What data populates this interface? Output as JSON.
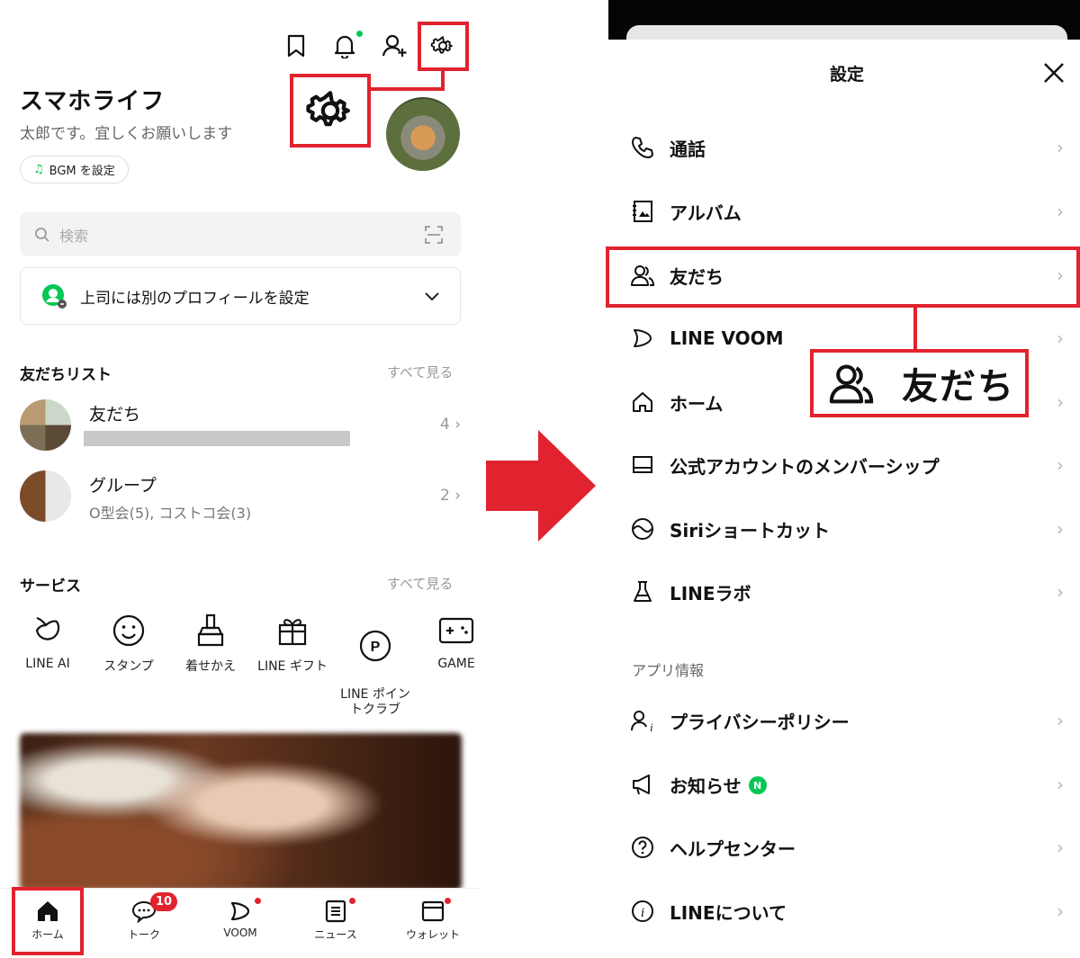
{
  "left": {
    "profile": {
      "name": "スマホライフ",
      "status": "太郎です。宜しくお願いします",
      "bgm_label": "BGM を設定"
    },
    "search": {
      "placeholder": "検索"
    },
    "profile_setting": {
      "label": "上司には別のプロフィールを設定"
    },
    "friends_list": {
      "title": "友だちリスト",
      "see_all": "すべて見る",
      "rows": [
        {
          "title": "友だち",
          "sub": "",
          "count": "4"
        },
        {
          "title": "グループ",
          "sub": "O型会(5), コストコ会(3)",
          "count": "2"
        }
      ]
    },
    "services": {
      "title": "サービス",
      "see_all": "すべて見る",
      "items": [
        {
          "label": "LINE AI",
          "icon": "line-ai-icon"
        },
        {
          "label": "スタンプ",
          "icon": "smiley-icon"
        },
        {
          "label": "着せかえ",
          "icon": "brush-icon"
        },
        {
          "label": "LINE ギフト",
          "icon": "gift-icon"
        },
        {
          "label": "LINE ポイン\nトクラブ",
          "icon": "point-icon"
        },
        {
          "label": "GAME",
          "icon": "gamepad-icon"
        }
      ]
    },
    "tabs": [
      {
        "label": "ホーム",
        "icon": "home-icon"
      },
      {
        "label": "トーク",
        "icon": "chat-icon",
        "badge": "10"
      },
      {
        "label": "VOOM",
        "icon": "voom-icon"
      },
      {
        "label": "ニュース",
        "icon": "news-icon"
      },
      {
        "label": "ウォレット",
        "icon": "wallet-icon"
      }
    ]
  },
  "right": {
    "title": "設定",
    "menu": [
      {
        "label": "通話",
        "icon": "phone-icon"
      },
      {
        "label": "アルバム",
        "icon": "album-icon"
      },
      {
        "label": "友だち",
        "icon": "friends-icon"
      },
      {
        "label": "LINE VOOM",
        "icon": "voom-icon"
      },
      {
        "label": "ホーム",
        "icon": "home-icon"
      },
      {
        "label": "公式アカウントのメンバーシップ",
        "icon": "membership-icon"
      },
      {
        "label": "Siriショートカット",
        "icon": "siri-icon"
      },
      {
        "label": "LINEラボ",
        "icon": "flask-icon"
      }
    ],
    "app_info_title": "アプリ情報",
    "app_info_menu": [
      {
        "label": "プライバシーポリシー",
        "icon": "privacy-icon"
      },
      {
        "label": "お知らせ",
        "icon": "megaphone-icon",
        "badge": "N"
      },
      {
        "label": "ヘルプセンター",
        "icon": "help-icon"
      },
      {
        "label": "LINEについて",
        "icon": "info-icon"
      }
    ],
    "callout_label": "友だち"
  },
  "colors": {
    "accent_red": "#e0232e",
    "line_green": "#06c755"
  }
}
